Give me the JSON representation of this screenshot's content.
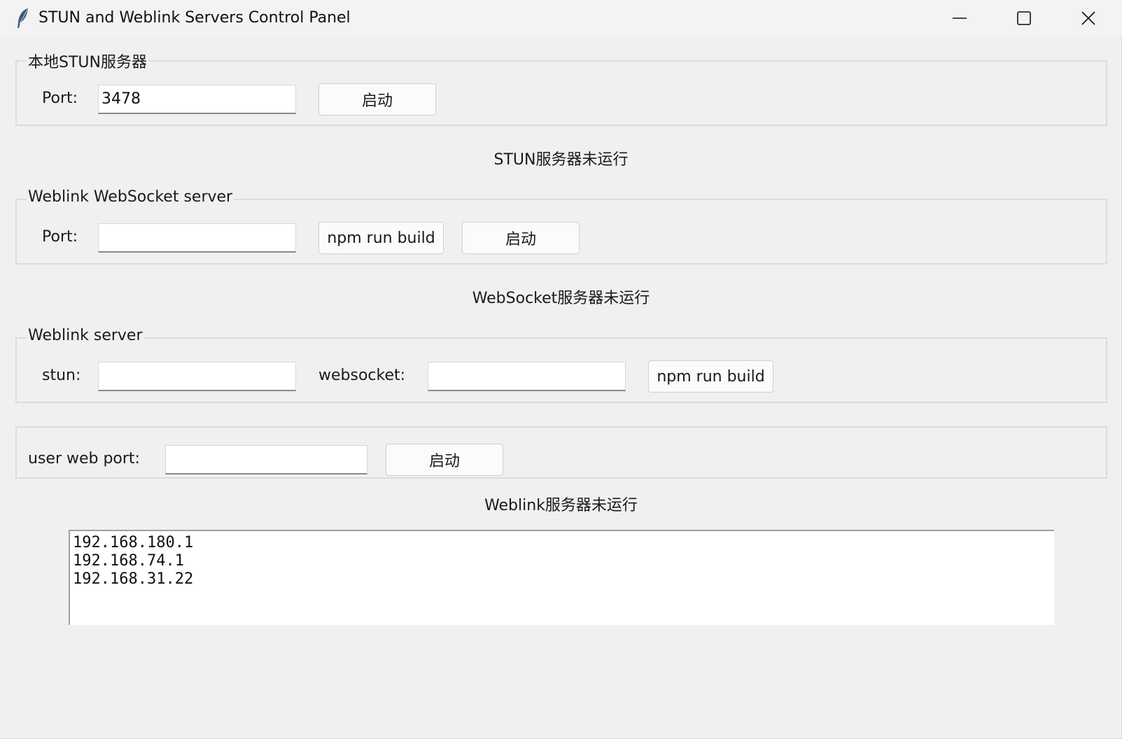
{
  "window": {
    "title": "STUN and Weblink Servers Control Panel",
    "icon": "feather-icon"
  },
  "stun_group": {
    "legend": "本地STUN服务器",
    "port_label": "Port:",
    "port_value": "3478",
    "start_button": "启动",
    "status": "STUN服务器未运行"
  },
  "ws_group": {
    "legend": "Weblink WebSocket server",
    "port_label": "Port:",
    "port_value": "",
    "build_button": "npm run build",
    "start_button": "启动",
    "status": "WebSocket服务器未运行"
  },
  "weblink_group": {
    "legend": "Weblink server",
    "stun_label": "stun:",
    "stun_value": "",
    "websocket_label": "websocket:",
    "websocket_value": "",
    "build_button": "npm run build"
  },
  "user_web_group": {
    "port_label": "user web port:",
    "port_value": "",
    "start_button": "启动",
    "status": "Weblink服务器未运行"
  },
  "ip_list": [
    "192.168.180.1",
    "192.168.74.1",
    "192.168.31.22"
  ],
  "colors": {
    "background": "#f0f0f0",
    "entry_background": "#ffffff"
  }
}
